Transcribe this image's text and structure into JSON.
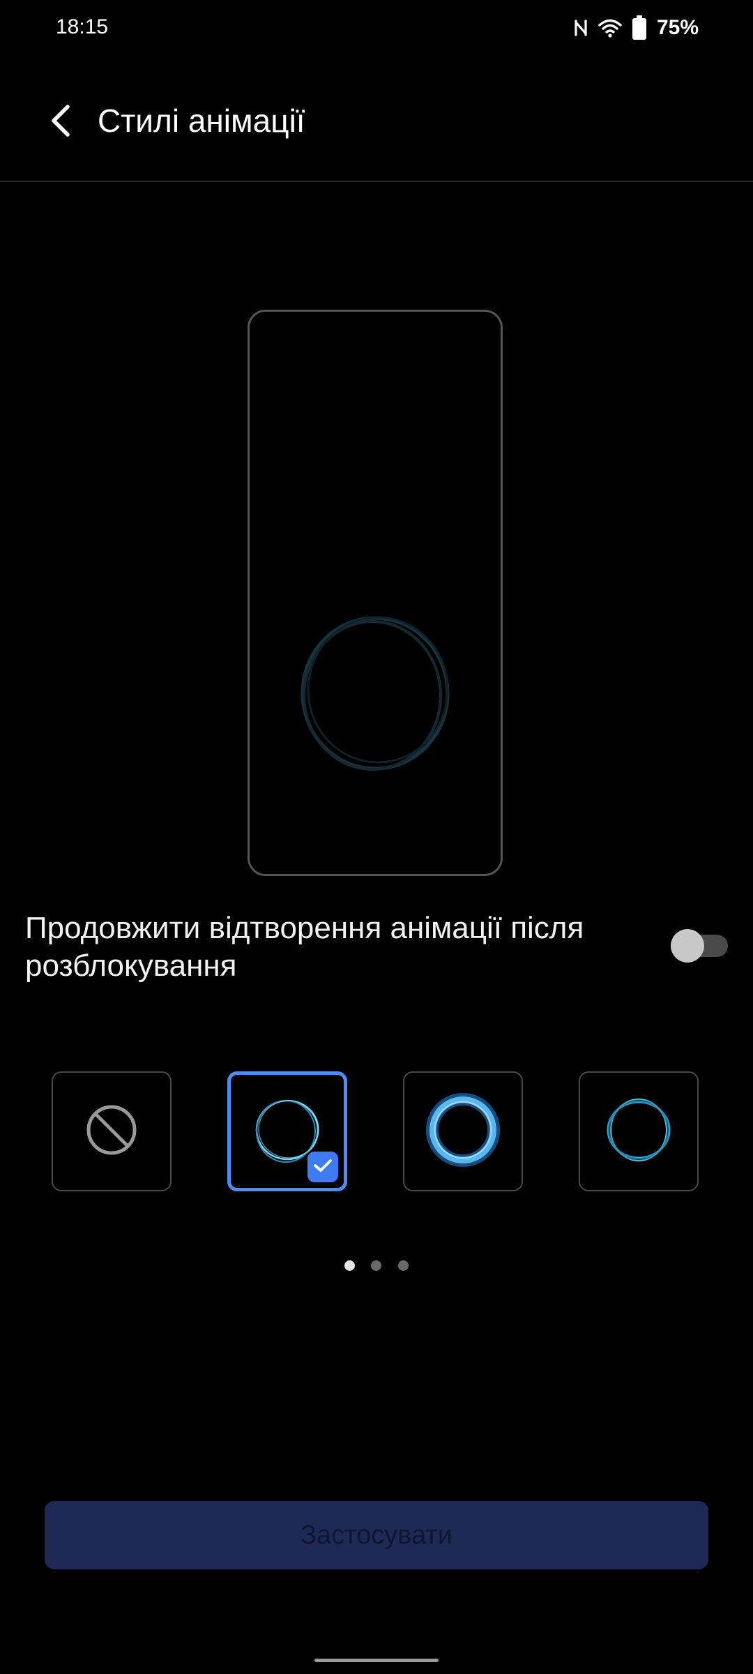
{
  "status_bar": {
    "time": "18:15",
    "battery_percent": "75%",
    "icons": [
      "nfc-icon",
      "wifi-icon",
      "battery-icon"
    ]
  },
  "header": {
    "title": "Стилі анімації",
    "back_icon": "chevron-left-icon"
  },
  "preview": {
    "animation": "ring"
  },
  "option": {
    "label": "Продовжити відтворення анімації після розблокування",
    "enabled": false
  },
  "styles": {
    "tiles": [
      {
        "icon": "none-icon",
        "selected": false
      },
      {
        "icon": "thin-ring-icon",
        "selected": true
      },
      {
        "icon": "glow-ring-icon",
        "selected": false
      },
      {
        "icon": "wave-ring-icon",
        "selected": false
      }
    ],
    "page_count": 3,
    "active_page": 1
  },
  "apply_button": {
    "label": "Застосувати"
  },
  "colors": {
    "accent": "#4d8df5",
    "ring": "#45c2e8",
    "button_bg": "#1e2a55"
  }
}
